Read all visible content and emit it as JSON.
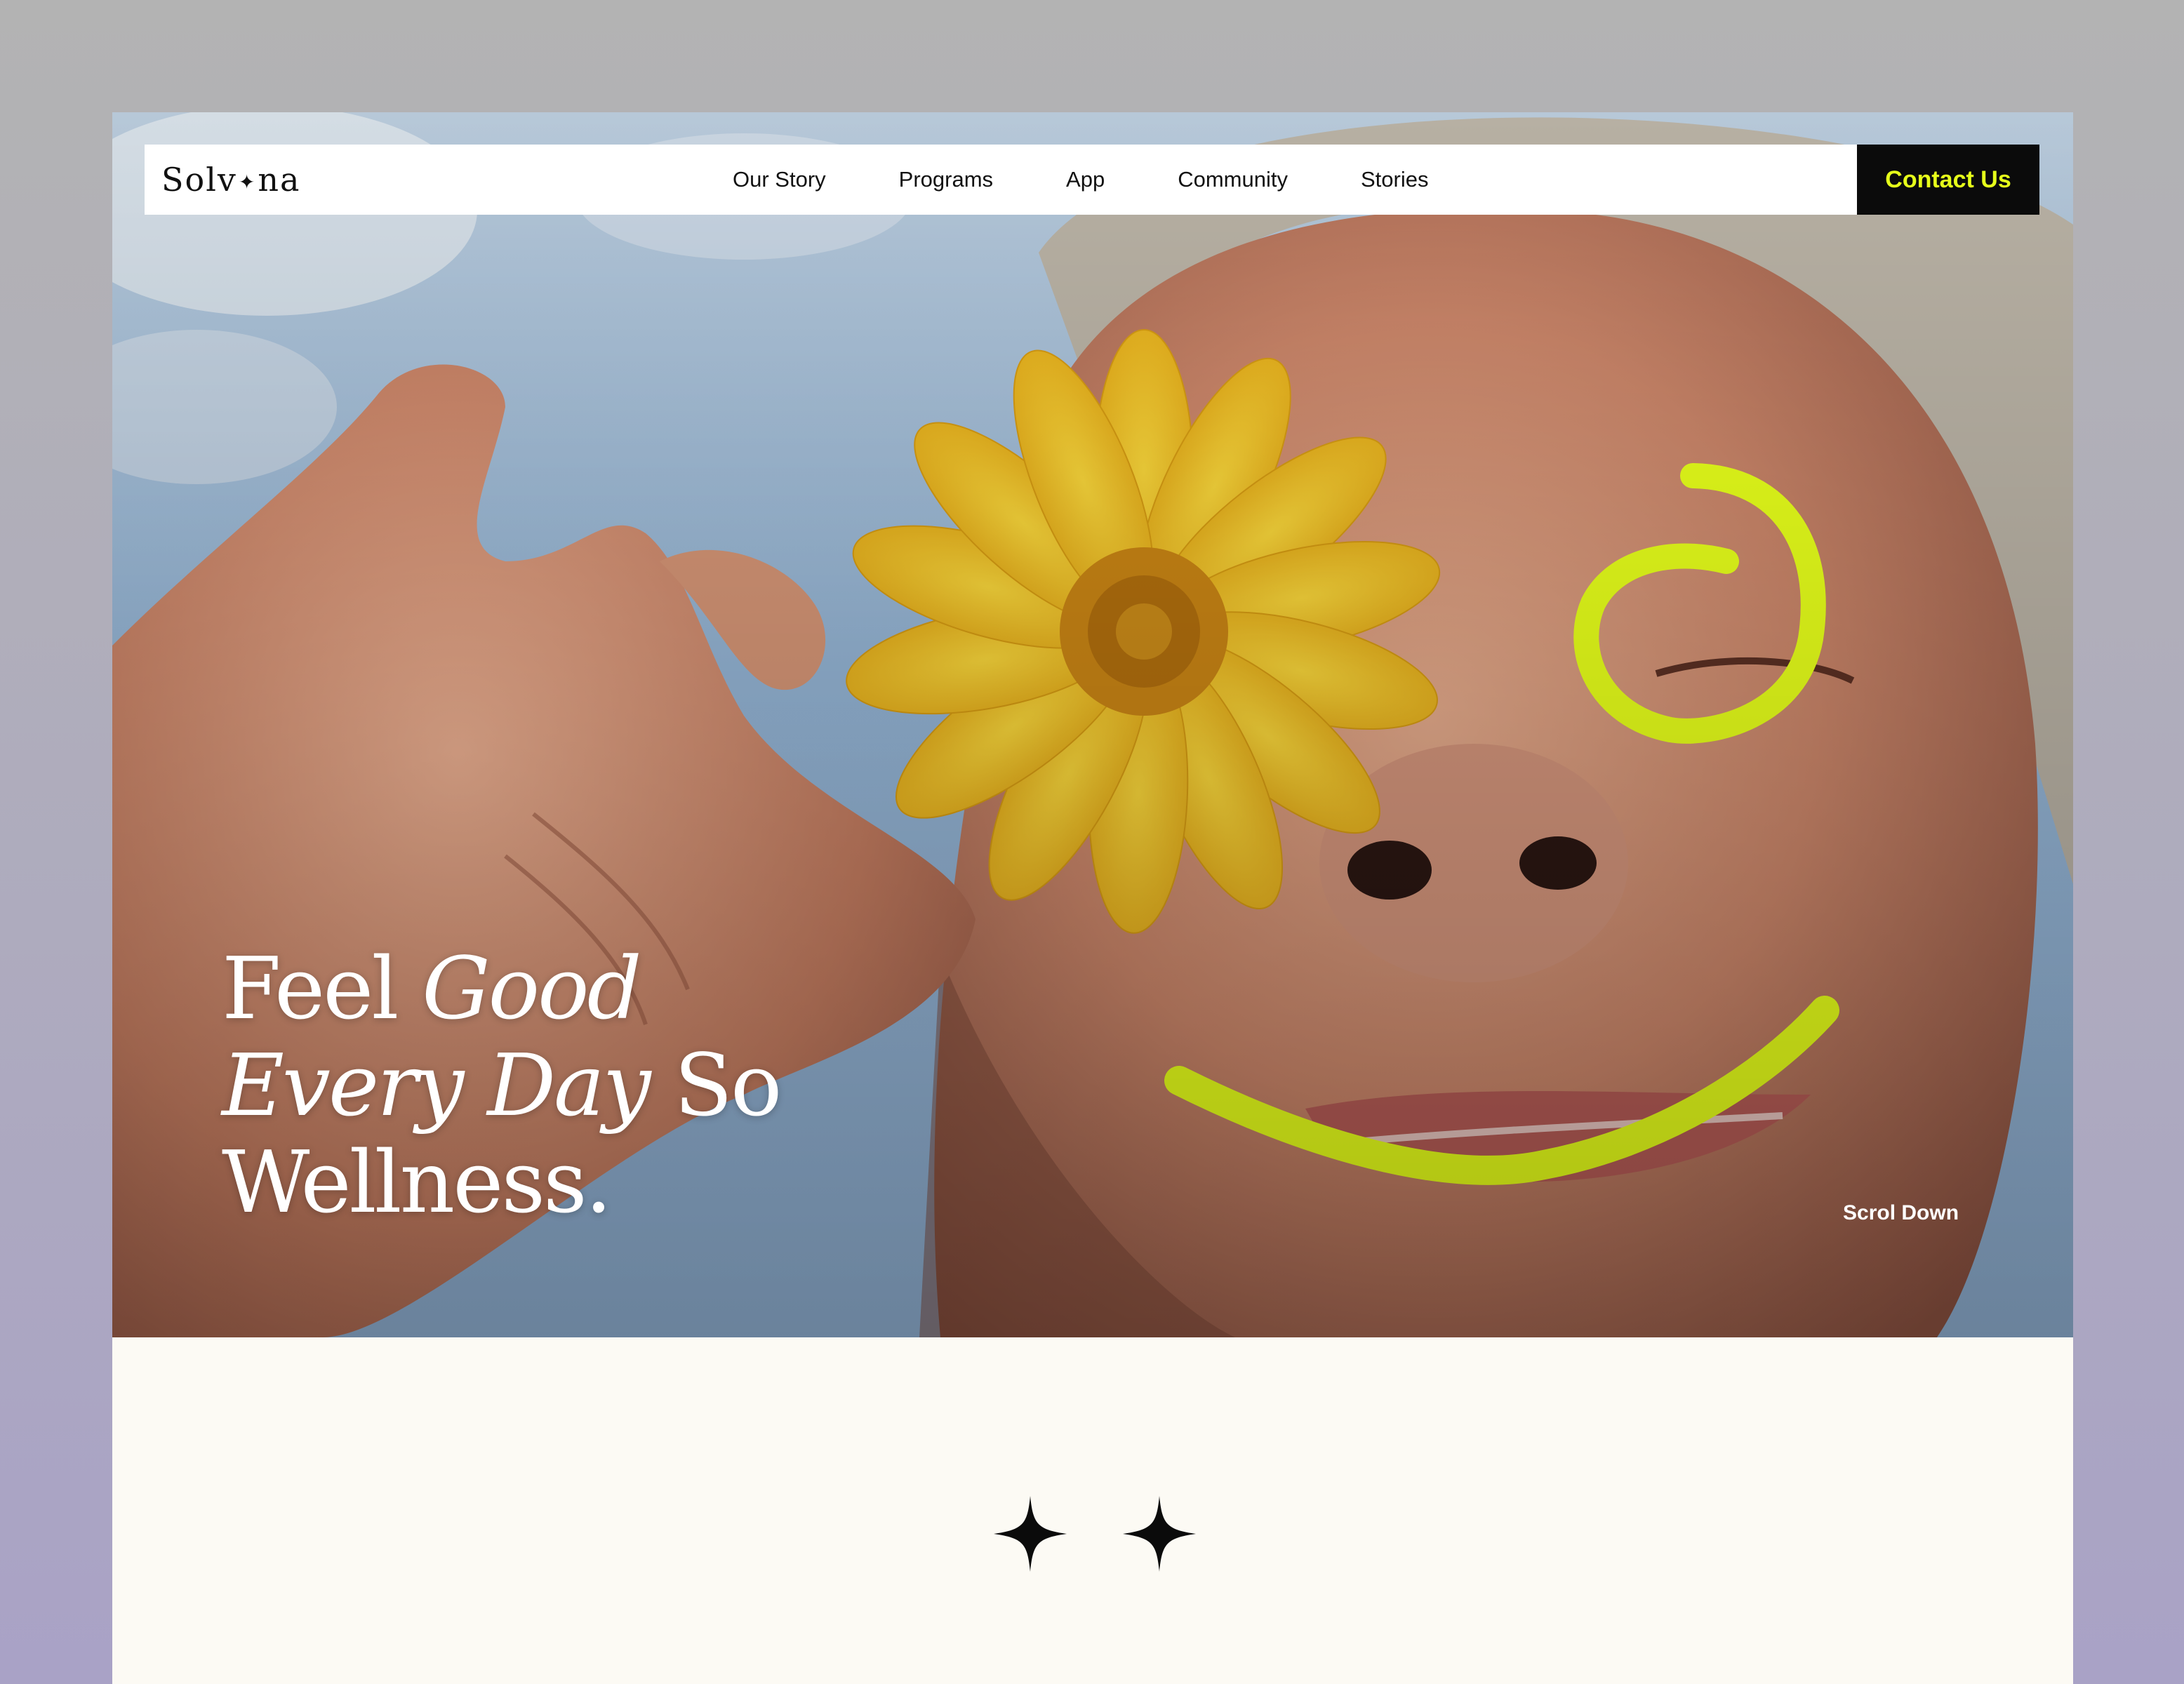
{
  "brand": {
    "logo_left": "Solv",
    "logo_right": "na"
  },
  "nav": {
    "items": [
      "Our Story",
      "Programs",
      "App",
      "Community",
      "Stories"
    ],
    "cta_label": "Contact Us"
  },
  "hero": {
    "line1_regular": "Feel ",
    "line1_italic": "Good",
    "line2_italic": "Every Day",
    "line2_regular": " So",
    "line3": "Wellness.",
    "scroll_label": "Scrol Down"
  },
  "colors": {
    "accent": "#e6ff1a",
    "cta_background": "#0b0b0b",
    "section_background": "#fcfaf4"
  },
  "icons": [
    "sparkle-icon",
    "four-point-star-icon"
  ]
}
